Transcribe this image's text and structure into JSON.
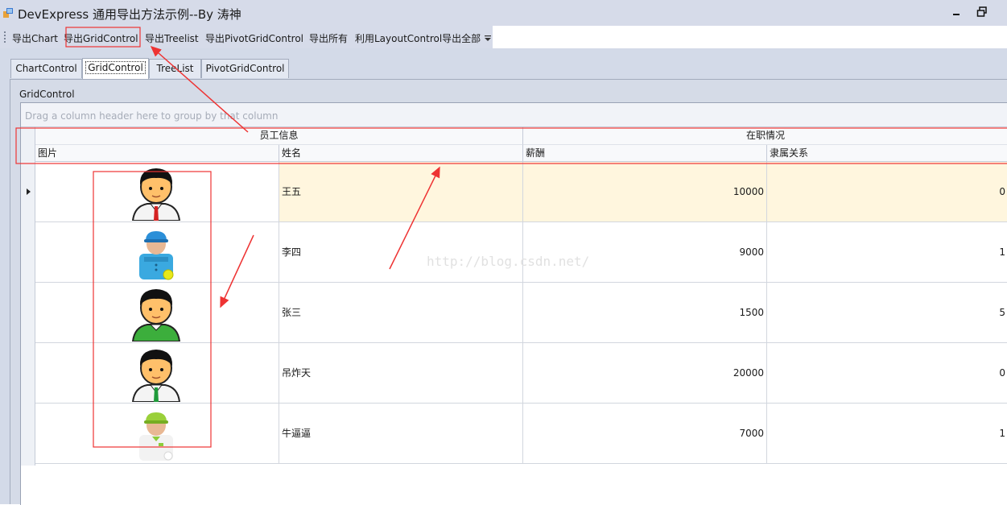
{
  "window": {
    "title": "DevExpress 通用导出方法示例--By 涛神"
  },
  "toolbar": {
    "items": [
      "导出Chart",
      "导出GridControl",
      "导出Treelist",
      "导出PivotGridControl",
      "导出所有",
      "利用LayoutControl导出全部"
    ]
  },
  "tabs": [
    "ChartControl",
    "GridControl",
    "TreeList",
    "PivotGridControl"
  ],
  "active_tab": "GridControl",
  "panel": {
    "label": "GridControl"
  },
  "grid": {
    "group_panel_text": "Drag a column header here to group by that column",
    "bands": [
      "员工信息",
      "在职情况"
    ],
    "columns": [
      "图片",
      "姓名",
      "薪酬",
      "隶属关系"
    ],
    "rows": [
      {
        "avatar": "male-red-tie-avatar-icon",
        "name": "王五",
        "salary": "10000",
        "relation": "0"
      },
      {
        "avatar": "blue-cap-worker-avatar-icon",
        "name": "李四",
        "salary": "9000",
        "relation": "1"
      },
      {
        "avatar": "male-green-shirt-avatar-icon",
        "name": "张三",
        "salary": "1500",
        "relation": "5"
      },
      {
        "avatar": "male-green-tie-avatar-icon",
        "name": "吊炸天",
        "salary": "20000",
        "relation": "0"
      },
      {
        "avatar": "green-cap-worker-avatar-icon",
        "name": "牛逼逼",
        "salary": "7000",
        "relation": "1"
      }
    ]
  },
  "watermark": "http://blog.csdn.net/",
  "colors": {
    "chrome": "#d6dbe9",
    "focused_row": "#fff6de",
    "annotation": "#ee3333"
  }
}
